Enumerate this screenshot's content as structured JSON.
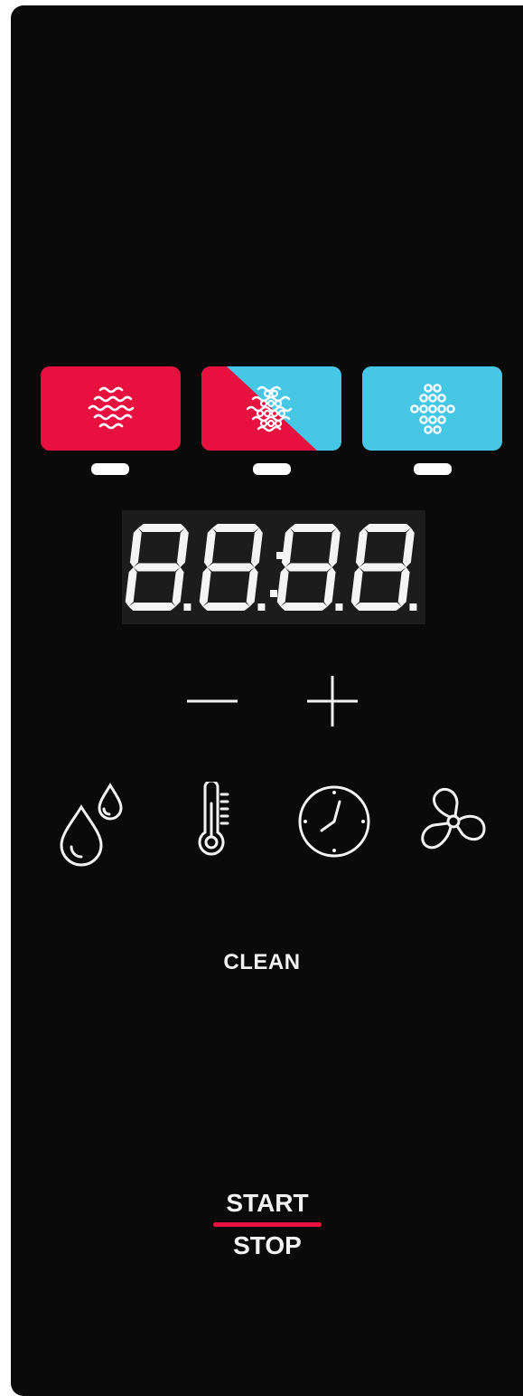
{
  "panel": {
    "background": "#0a0a0a"
  },
  "modes": [
    {
      "name": "convection",
      "icon": "wave-icon",
      "color": "#e8103f"
    },
    {
      "name": "combi",
      "icon": "wave-and-steam-icon",
      "colors": [
        "#e8103f",
        "#47c7e6"
      ]
    },
    {
      "name": "steam",
      "icon": "steam-dots-icon",
      "color": "#47c7e6"
    }
  ],
  "display": {
    "digits": "88:88",
    "segment_color": "#f4f4f4"
  },
  "controls": {
    "minus": "minus-icon",
    "plus": "plus-icon"
  },
  "functions": [
    {
      "icon": "humidity-drops-icon"
    },
    {
      "icon": "thermometer-icon"
    },
    {
      "icon": "clock-icon"
    },
    {
      "icon": "fan-icon"
    }
  ],
  "clean_label": "CLEAN",
  "start_label": "START",
  "stop_label": "STOP",
  "accent_color": "#e8103f"
}
